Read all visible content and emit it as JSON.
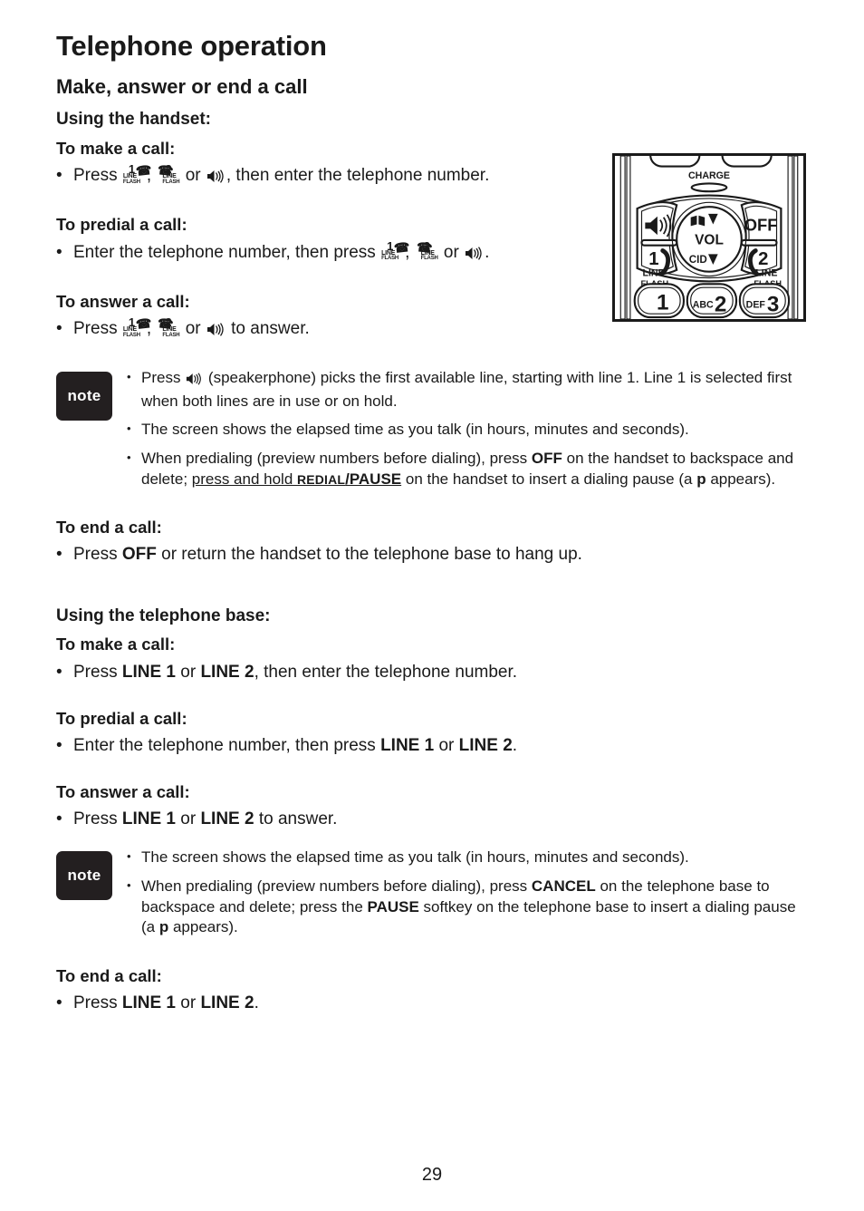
{
  "document": {
    "chapter_title": "Telephone operation",
    "section_title": "Make, answer or end a call",
    "page_number": "29"
  },
  "handset": {
    "heading": "Using the handset:",
    "make": {
      "title": "To make a call:",
      "text_before": "Press ",
      "text_mid": ", ",
      "text_or": " or ",
      "text_after": ", then enter the telephone number."
    },
    "predial": {
      "title": "To predial a call:",
      "text_before": "Enter the telephone number, then press ",
      "text_mid": ", ",
      "text_or": " or ",
      "text_after": "."
    },
    "answer": {
      "title": "To answer a call:",
      "text_before": "Press ",
      "text_mid": ", ",
      "text_or": " or ",
      "text_after": " to answer."
    },
    "end": {
      "title": "To end a call:",
      "part1": "Press ",
      "bold_off": "OFF",
      "part2": " or return the handset to the telephone base to hang up."
    },
    "note": {
      "badge": "note",
      "item1_a": "Press ",
      "item1_b": " (speakerphone) picks the first available line, starting with line 1. Line 1 is selected first when both lines are in use or on hold.",
      "item2": "The screen shows the elapsed time as you talk (in hours, minutes and seconds).",
      "item3_a": "When predialing (preview numbers before dialing), press ",
      "item3_off": "OFF",
      "item3_b": " on the handset to backspace and delete; ",
      "item3_underline": "press and hold ",
      "item3_redial": "REDIAL",
      "item3_pause": "/PAUSE",
      "item3_c": " on the handset to insert a dialing pause (a ",
      "item3_p": "p",
      "item3_d": " appears)."
    }
  },
  "base": {
    "heading": "Using the telephone base:",
    "make": {
      "title": "To make a call:",
      "part1": "Press ",
      "line1": "LINE 1",
      "or": " or ",
      "line2": "LINE 2",
      "part2": ", then enter the telephone number."
    },
    "predial": {
      "title": "To predial a call:",
      "part1": "Enter the telephone number, then press ",
      "line1": "LINE 1",
      "or": " or ",
      "line2": "LINE 2",
      "part2": "."
    },
    "answer": {
      "title": "To answer a call:",
      "part1": "Press ",
      "line1": "LINE 1",
      "or": " or ",
      "line2": "LINE 2",
      "part2": " to answer."
    },
    "end": {
      "title": "To end a call:",
      "part1": "Press ",
      "line1": "LINE 1",
      "or": " or ",
      "line2": "LINE 2",
      "part2": "."
    },
    "note": {
      "badge": "note",
      "item1": "The screen shows the elapsed time as you talk (in hours, minutes and seconds).",
      "item2_a": "When predialing (preview numbers before dialing), press ",
      "item2_cancel": "CANCEL",
      "item2_b": " on the telephone base to backspace and delete; press the ",
      "item2_pause": "PAUSE",
      "item2_c": " softkey on the telephone base to insert a dialing pause (a ",
      "item2_p": "p",
      "item2_d": " appears)."
    }
  },
  "line_key_glyph": {
    "line1_num": "1",
    "line2_num": "2",
    "line_label": "LINE",
    "flash_label": "FLASH",
    "handset_glyph": "✆"
  },
  "phone_figure": {
    "charge_label": "CHARGE",
    "off_label": "OFF",
    "vol_label": "VOL",
    "cid_label": "CID",
    "up_arrow": "▲",
    "down_arrow": "▼",
    "line1_num": "1",
    "line2_num": "2",
    "line_label": "LINE",
    "flash_label": "FLASH",
    "key1": "1",
    "key2": "2",
    "key3": "3",
    "key2_letters": "ABC",
    "key3_letters": "DEF"
  },
  "colors": {
    "ink": "#1a1a1a",
    "note_badge_bg": "#231f20",
    "page_bg": "#ffffff"
  }
}
